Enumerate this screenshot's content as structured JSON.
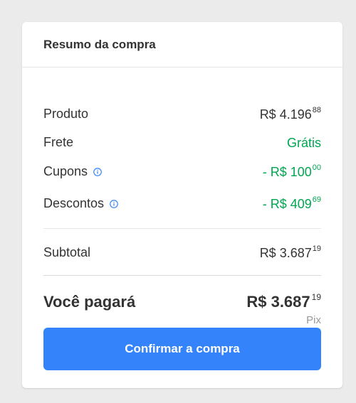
{
  "summary": {
    "title": "Resumo da compra",
    "rows": [
      {
        "label": "Produto",
        "prefix": "R$ 4.196",
        "cents": "88",
        "has_info": false,
        "color": "#333333"
      },
      {
        "label": "Frete",
        "prefix": "Grátis",
        "cents": "",
        "has_info": false,
        "color": "#00a650"
      },
      {
        "label": "Cupons",
        "prefix": "- R$ 100",
        "cents": "00",
        "has_info": true,
        "color": "#00a650"
      },
      {
        "label": "Descontos",
        "prefix": "- R$ 409",
        "cents": "69",
        "has_info": true,
        "color": "#00a650"
      }
    ],
    "subtotal": {
      "label": "Subtotal",
      "prefix": "R$ 3.687",
      "cents": "19"
    },
    "total": {
      "label": "Você pagará",
      "prefix": "R$ 3.687",
      "cents": "19",
      "method": "Pix"
    },
    "confirm_label": "Confirmar a compra"
  },
  "colors": {
    "accent": "#3483fa",
    "success": "#00a650",
    "info_icon": "#3483fa"
  },
  "icons": {
    "info": "info-icon"
  }
}
